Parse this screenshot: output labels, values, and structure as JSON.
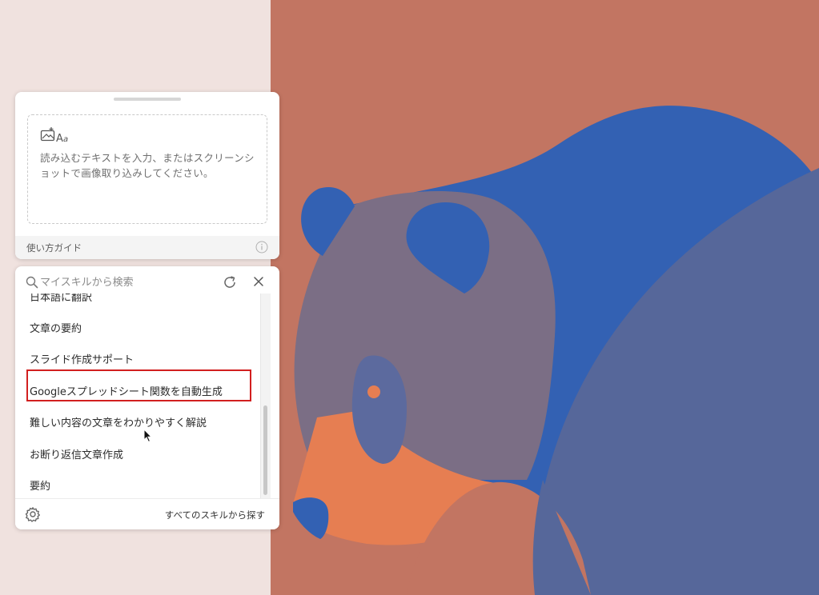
{
  "capture_panel": {
    "drop_text": "読み込むテキストを入力、またはスクリーンショットで画像取り込みしてください。",
    "drop_icon": "image-text-icon",
    "guide_link": "使い方ガイド",
    "info_icon": "info-icon"
  },
  "skills_panel": {
    "search_placeholder": "マイスキルから検索",
    "refresh_icon": "refresh-icon",
    "close_icon": "close-icon",
    "items": [
      {
        "label": "日本語に翻訳"
      },
      {
        "label": "文章の要約"
      },
      {
        "label": "スライド作成サポート",
        "highlighted": true
      },
      {
        "label": "Googleスプレッドシート関数を自動生成"
      },
      {
        "label": "難しい内容の文章をわかりやすく解説"
      },
      {
        "label": "お断り返信文章作成"
      },
      {
        "label": "要約"
      }
    ],
    "footer": {
      "settings_icon": "gear-icon",
      "all_skills_link": "すべてのスキルから探す"
    }
  },
  "colors": {
    "highlight_border": "#d21f1f",
    "wallpaper_bg": "#c27562",
    "bear_blue": "#3361b3",
    "bear_gray": "#7b6e85",
    "bear_orange": "#e67e52"
  }
}
